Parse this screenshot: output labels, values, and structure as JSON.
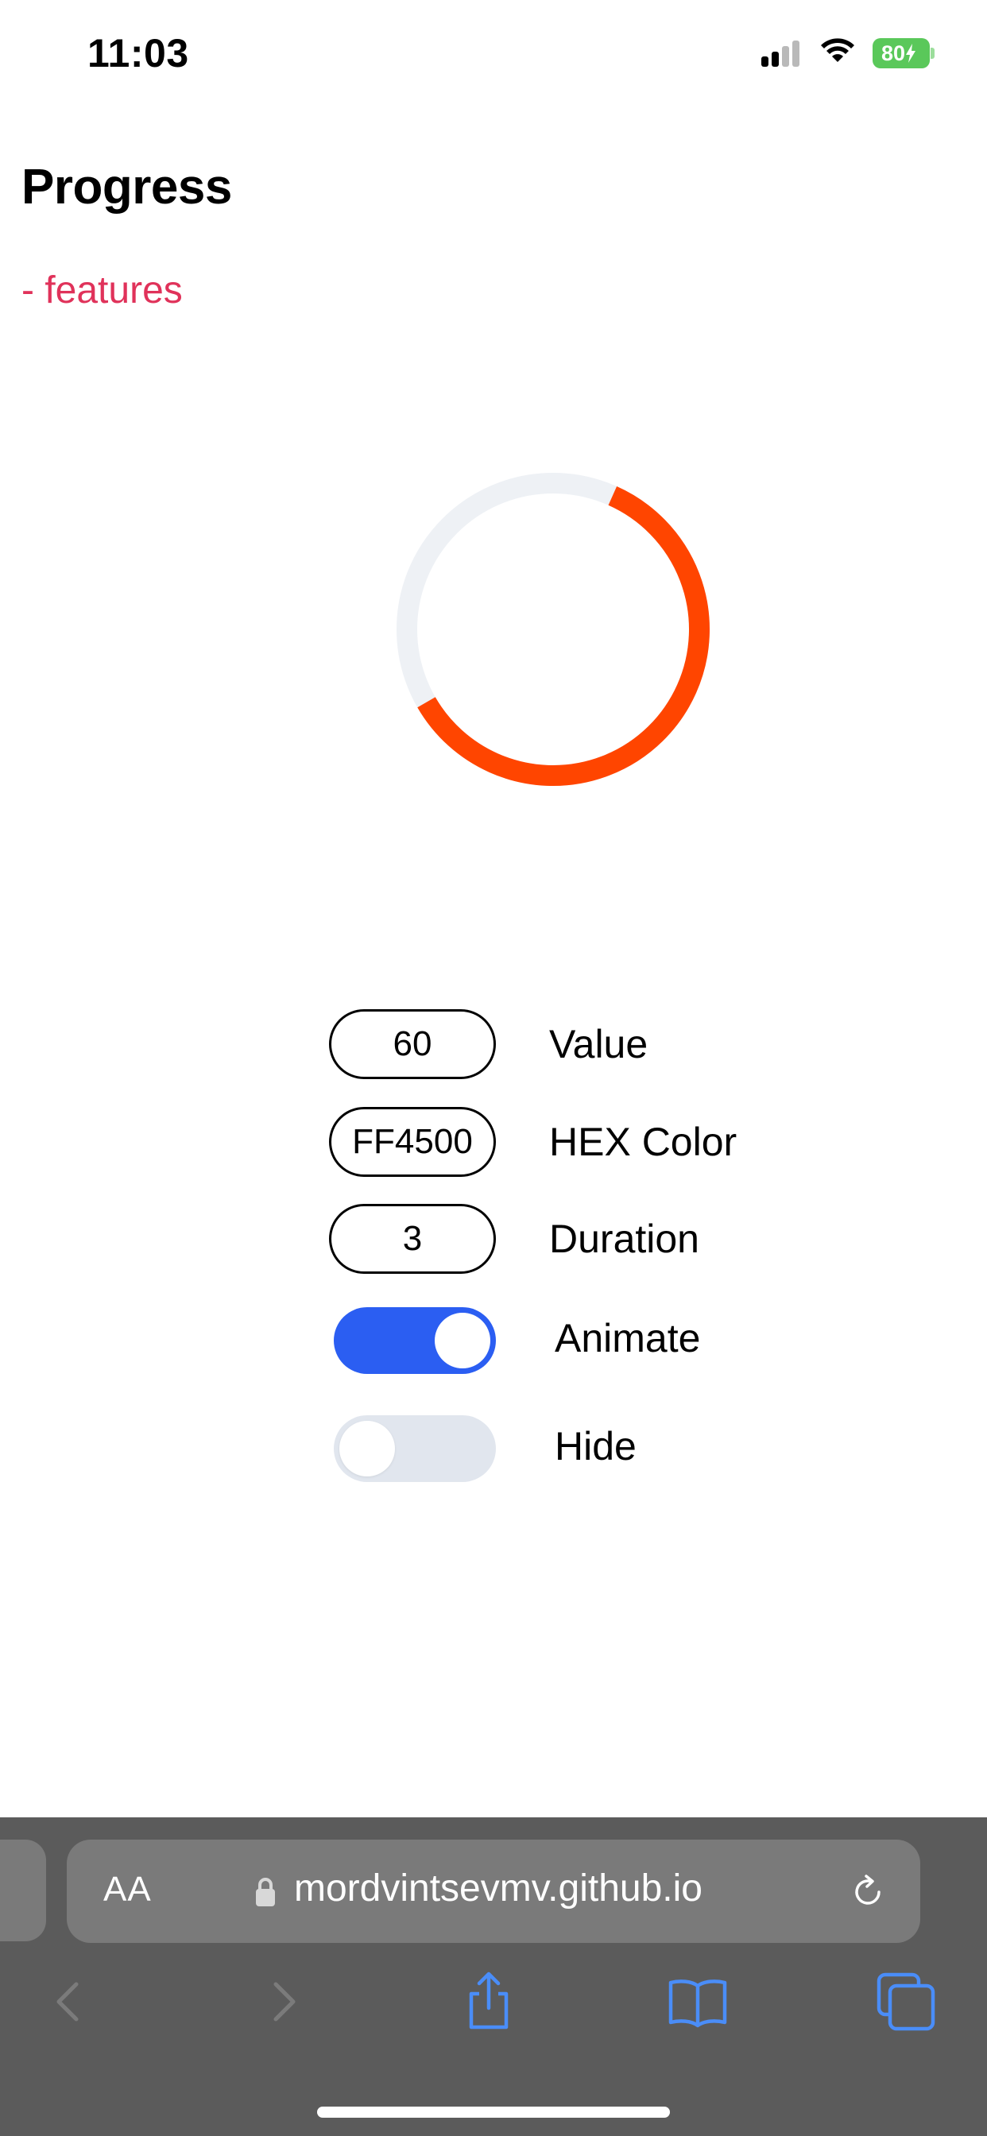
{
  "status_bar": {
    "time": "11:03",
    "battery_percent": "80",
    "battery_color": "#5ac85a",
    "signal_icon": "cellular-signal-icon",
    "wifi_icon": "wifi-icon",
    "charging_icon": "bolt-icon"
  },
  "page": {
    "title": "Progress",
    "features_link": "- features",
    "link_color": "#e0325a"
  },
  "progress": {
    "value_percent": 60,
    "color": "#FF4500",
    "track_color": "#eef1f5"
  },
  "controls": {
    "value": {
      "input": "60",
      "label": "Value"
    },
    "hex_color": {
      "input": "FF4500",
      "label": "HEX Color"
    },
    "duration": {
      "input": "3",
      "label": "Duration"
    },
    "animate": {
      "label": "Animate",
      "on": true
    },
    "hide": {
      "label": "Hide",
      "on": false
    },
    "toggle_on_color": "#2b5ef2",
    "toggle_off_color": "#e1e6ee"
  },
  "browser": {
    "text_size_button": "AA",
    "url": "mordvintsevmv.github.io",
    "lock_icon": "lock-icon",
    "reload_icon": "reload-icon",
    "toolbar": [
      "back-icon",
      "forward-icon",
      "share-icon",
      "bookmarks-icon",
      "tabs-icon"
    ],
    "accent_color": "#4a8df8"
  }
}
